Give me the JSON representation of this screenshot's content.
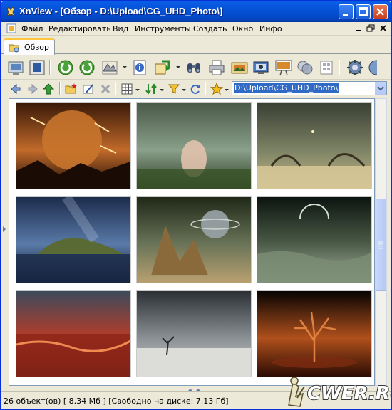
{
  "window": {
    "title": "XnView - [Обзор - D:\\Upload\\CG_UHD_Photo\\]",
    "accent": "#0a5fe6"
  },
  "menu": {
    "items": [
      "Файл",
      "Редактировать",
      "Вид",
      "Инструменты",
      "Создать",
      "Окно",
      "Инфо"
    ]
  },
  "tabs": {
    "active": "Обзор"
  },
  "address": {
    "path": "D:\\Upload\\CG_UHD_Photo\\"
  },
  "thumbnails": [
    {
      "name": "planet-meteors",
      "colors": [
        "#3a1a08",
        "#c26a2a",
        "#1a0c05"
      ]
    },
    {
      "name": "woman-in-meadow",
      "colors": [
        "#4a5a48",
        "#8aa08a",
        "#2c3a22"
      ]
    },
    {
      "name": "alien-lake",
      "colors": [
        "#3a4034",
        "#7c8264",
        "#c4b88a"
      ]
    },
    {
      "name": "floating-island",
      "colors": [
        "#1c2c4c",
        "#5a7aa8",
        "#0c1424"
      ]
    },
    {
      "name": "ringed-planet-rocks",
      "colors": [
        "#202818",
        "#6a7458",
        "#b8a070"
      ]
    },
    {
      "name": "eclipse-sea",
      "colors": [
        "#0c1410",
        "#4c5c48",
        "#a4b09c"
      ]
    },
    {
      "name": "red-sky-sea",
      "colors": [
        "#3c4a5c",
        "#b83c28",
        "#5c1c14"
      ]
    },
    {
      "name": "stormy-tree",
      "colors": [
        "#2c3034",
        "#8a9094",
        "#d0d0cc"
      ]
    },
    {
      "name": "glowing-tree",
      "colors": [
        "#060302",
        "#b0501c",
        "#2c0c04"
      ]
    }
  ],
  "status": {
    "text": "26 объект(ов) [ 8.34 Мб ] [Свободно на диске: 7.13 Гб]"
  },
  "watermark": {
    "text": "CWER.RU"
  }
}
